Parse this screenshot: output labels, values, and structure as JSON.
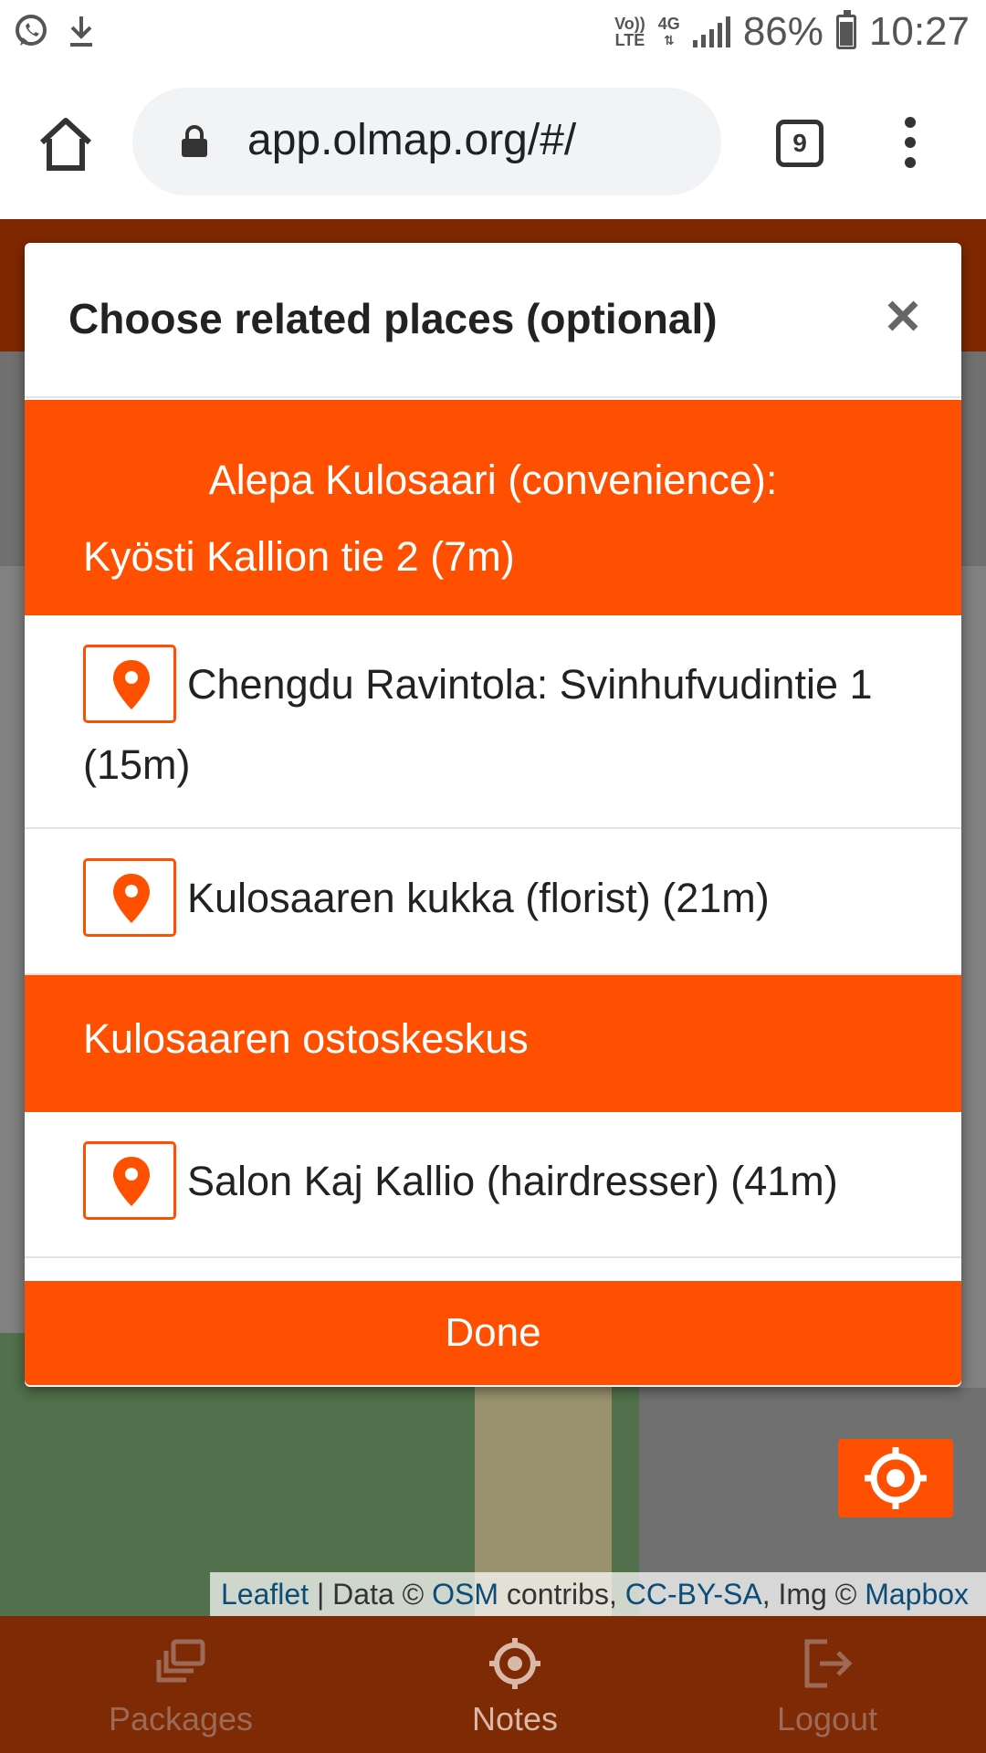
{
  "status_bar": {
    "network_top": "Vo))",
    "network_bottom": "LTE",
    "data_type": "4G",
    "battery": "86%",
    "time": "10:27"
  },
  "browser": {
    "url": "app.olmap.org/#/",
    "tab_count": "9"
  },
  "modal": {
    "title": "Choose related places (optional)",
    "close_label": "×",
    "groups": [
      {
        "line1": "Alepa Kulosaari (convenience):",
        "line2": "Kyösti Kallion tie 2 (7m)",
        "items": [
          {
            "label": "Chengdu Ravintola: Svinhufvudintie 1 (15m)"
          },
          {
            "label": "Kulosaaren kukka (florist) (21m)"
          }
        ]
      },
      {
        "line1": "Kulosaaren ostoskeskus",
        "items": [
          {
            "label": "Salon Kaj Kallio (hairdresser) (41m)"
          }
        ]
      }
    ],
    "done_label": "Done"
  },
  "attribution": {
    "leaflet": "Leaflet",
    "sep1": " | Data © ",
    "osm": "OSM",
    "mid": " contribs, ",
    "license": "CC-BY-SA",
    "img": ", Img © ",
    "mapbox": "Mapbox"
  },
  "bottom_nav": {
    "items": [
      {
        "label": "Packages",
        "icon": "layers-icon"
      },
      {
        "label": "Notes",
        "icon": "crosshair-icon"
      },
      {
        "label": "Logout",
        "icon": "logout-icon"
      }
    ]
  },
  "colors": {
    "accent": "#fe5000",
    "header_dark": "#7d2a05"
  }
}
